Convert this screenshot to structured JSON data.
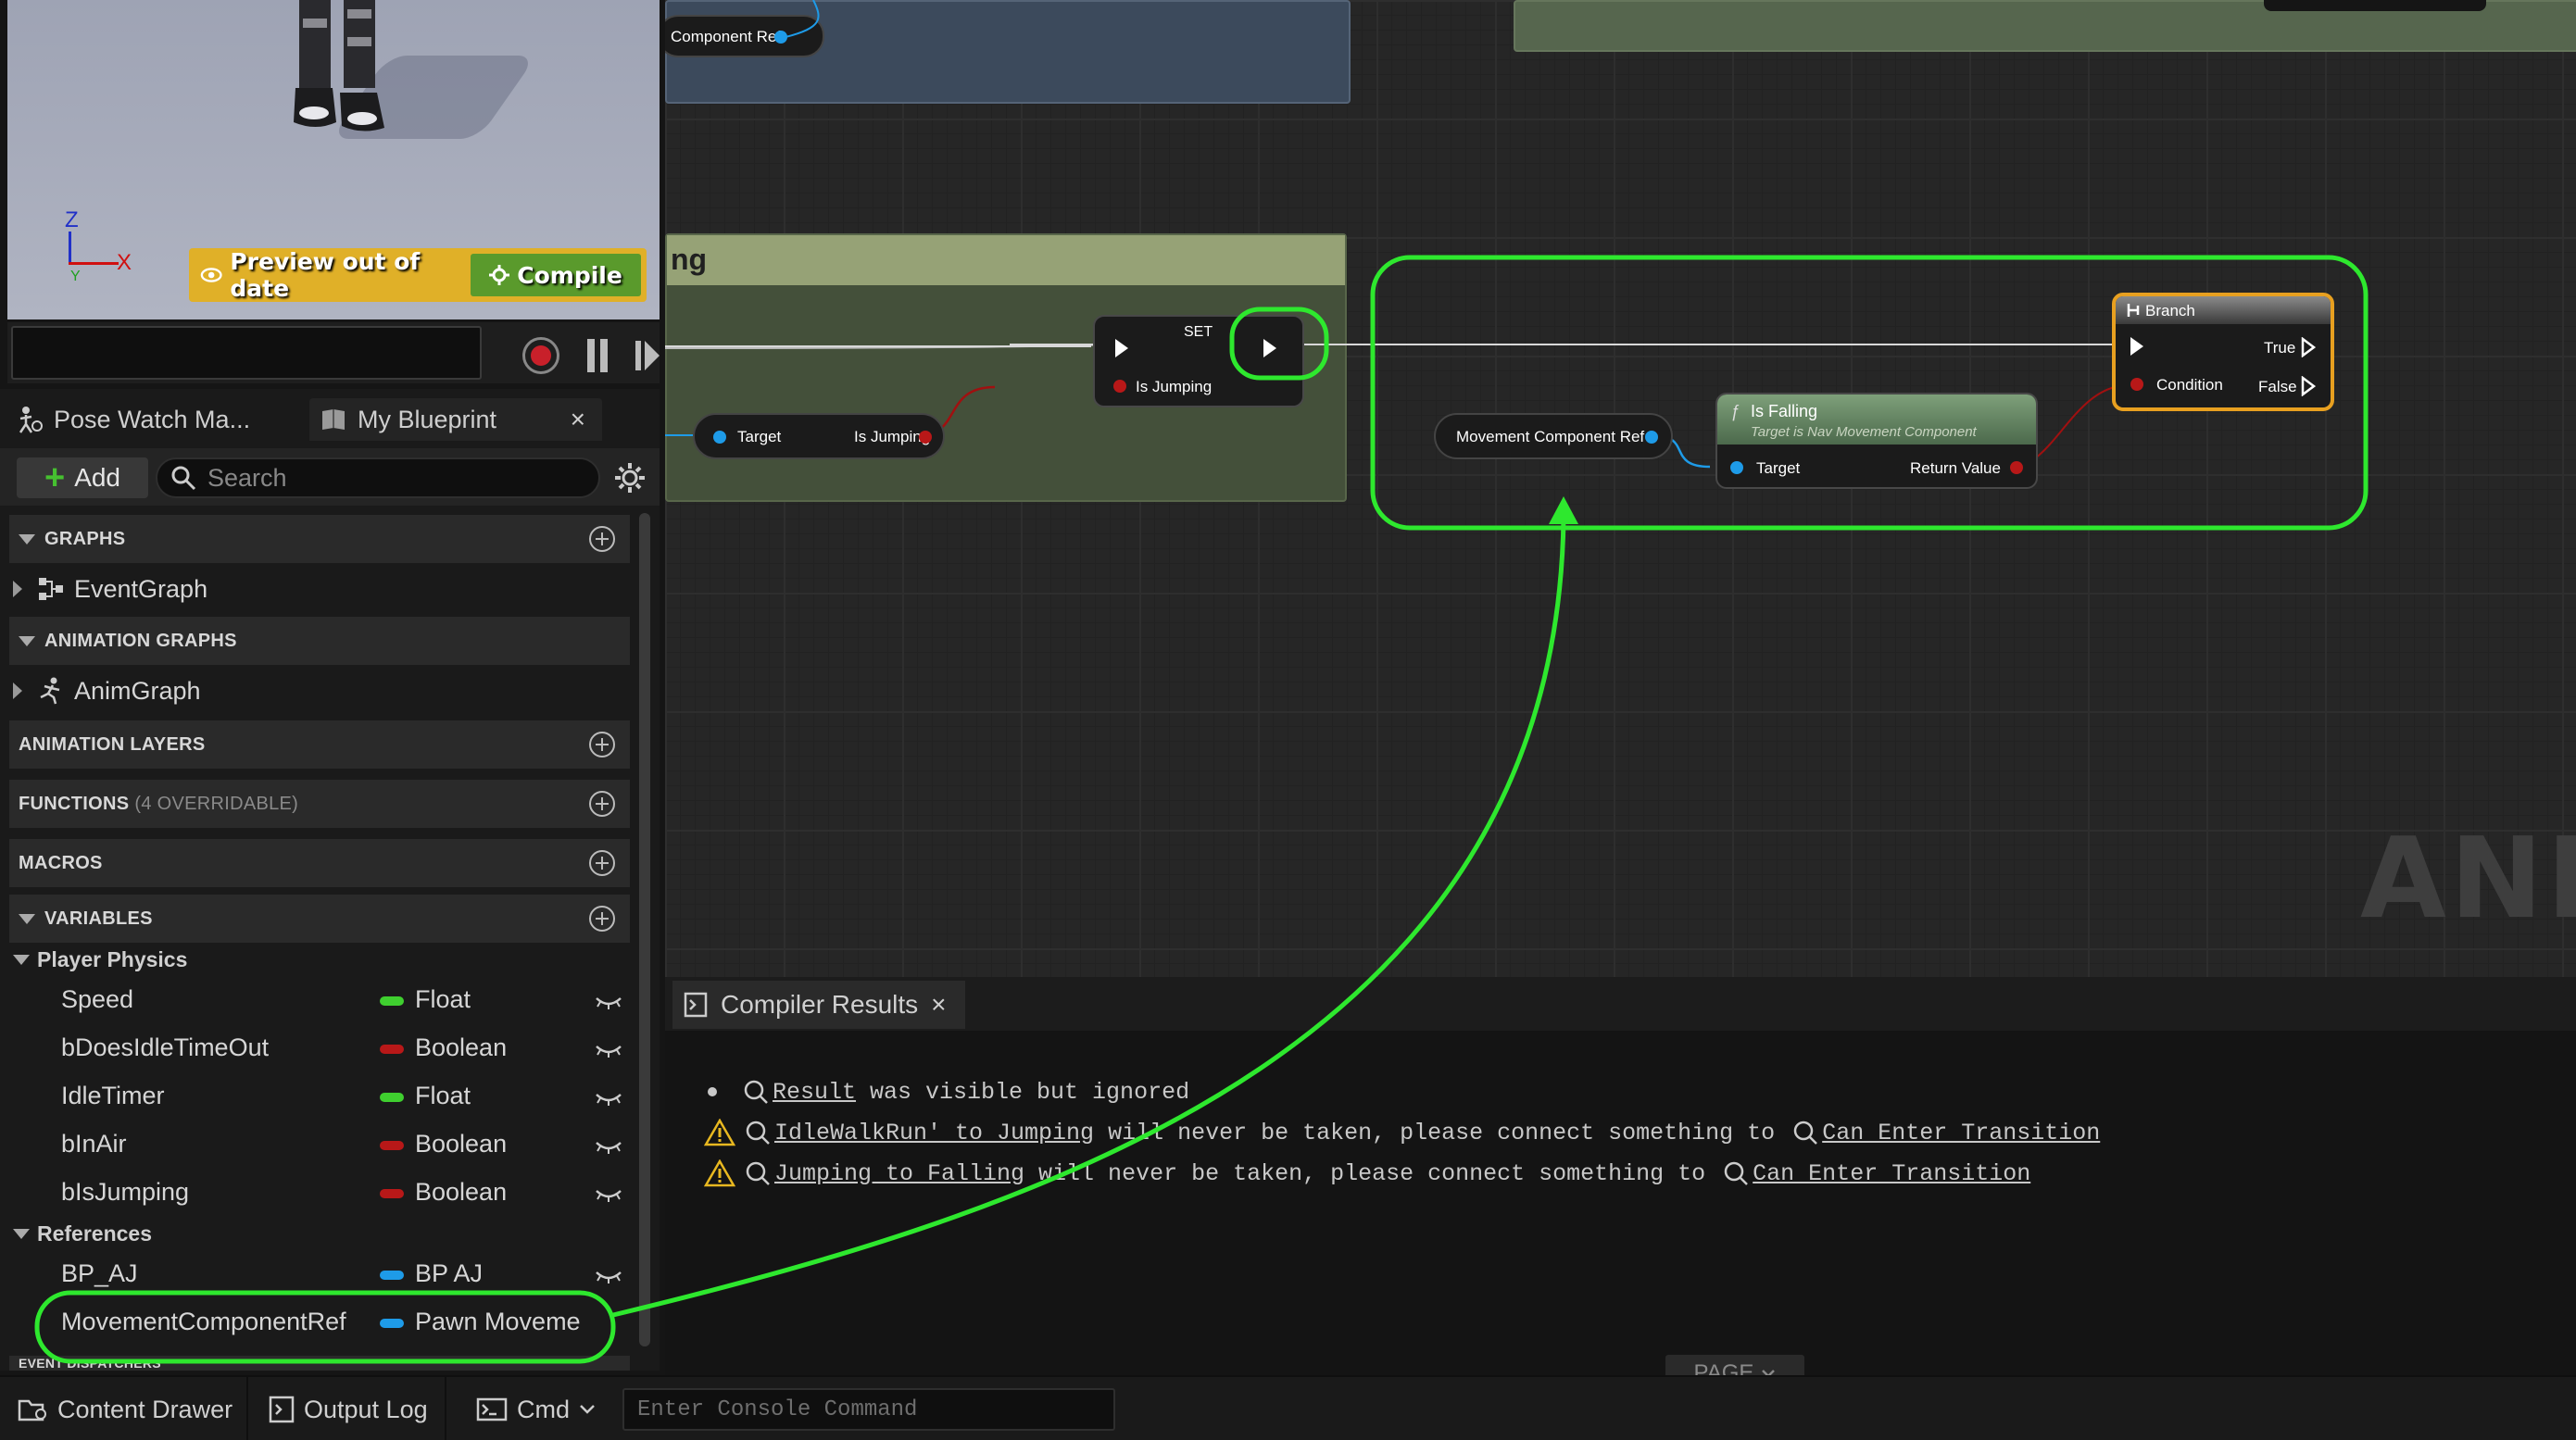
{
  "viewport": {
    "axis_z": "Z",
    "axis_x": "X",
    "axis_y": "Y",
    "preview_label": "Preview out of date",
    "compile_label": "Compile"
  },
  "panel": {
    "tab_pose": "Pose Watch Ma...",
    "tab_mybp": "My Blueprint",
    "tab_close": "×",
    "add_label": "Add",
    "search_placeholder": "Search",
    "sections": {
      "graphs": "GRAPHS",
      "anim_graphs": "ANIMATION GRAPHS",
      "anim_layers": "ANIMATION LAYERS",
      "functions": "FUNCTIONS",
      "functions_sub": "(4 OVERRIDABLE)",
      "macros": "MACROS",
      "variables": "VARIABLES",
      "event_dispatchers": "EVENT DISPATCHERS"
    },
    "event_graph": "EventGraph",
    "anim_graph": "AnimGraph",
    "cat_physics": "Player Physics",
    "cat_refs": "References",
    "variables": [
      {
        "name": "Speed",
        "type": "Float",
        "color": "#3fcf2f"
      },
      {
        "name": "bDoesIdleTimeOut",
        "type": "Boolean",
        "color": "#b81818"
      },
      {
        "name": "IdleTimer",
        "type": "Float",
        "color": "#3fcf2f"
      },
      {
        "name": "bInAir",
        "type": "Boolean",
        "color": "#b81818"
      },
      {
        "name": "bIsJumping",
        "type": "Boolean",
        "color": "#b81818"
      }
    ],
    "references": [
      {
        "name": "BP_AJ",
        "type": "BP AJ",
        "color": "#1e9be8"
      },
      {
        "name": "MovementComponentRef",
        "type": "Pawn Moveme",
        "color": "#1e9be8"
      }
    ]
  },
  "graph": {
    "top_node_label": "Component Ref",
    "comment_title": "ng",
    "set_title": "SET",
    "set_pin_label": "Is Jumping",
    "get_target": "Target",
    "get_isjumping": "Is Jumping",
    "movement_ref": "Movement Component Ref",
    "isfalling_title": "Is Falling",
    "isfalling_sub": "Target is Nav Movement Component",
    "isfalling_target": "Target",
    "isfalling_return": "Return Value",
    "branch_title": "Branch",
    "branch_condition": "Condition",
    "branch_true": "True",
    "branch_false": "False",
    "watermark": "ANIM"
  },
  "compiler": {
    "tab": "Compiler Results",
    "tab_close": "×",
    "msg1_link": "Result",
    "msg1_text": " was visible but ignored",
    "msg2_link": "IdleWalkRun' to Jumping",
    "msg2_text": " will never be taken, please connect something to ",
    "msg2_link2": "Can Enter Transition",
    "msg3_link": "Jumping to Falling",
    "msg3_text": " will never be taken, please connect something to ",
    "msg3_link2": "Can Enter Transition",
    "page_label": "PAGE"
  },
  "bottom": {
    "content_drawer": "Content Drawer",
    "output_log": "Output Log",
    "cmd": "Cmd",
    "console_placeholder": "Enter Console Command"
  },
  "colors": {
    "highlight": "#2ee82e",
    "bool_pin": "#b81818",
    "object_pin": "#1e9be8",
    "float_pin": "#3fcf2f",
    "branch_border": "#e8a020"
  },
  "icons": [
    "eye-icon",
    "gear-icon",
    "record-icon",
    "pause-icon",
    "step-icon",
    "search-icon",
    "settings-icon",
    "blueprint-icon",
    "graph-icon",
    "anim-icon",
    "warning-icon",
    "function-icon",
    "branch-icon",
    "log-icon",
    "cmd-icon",
    "content-drawer-icon"
  ]
}
